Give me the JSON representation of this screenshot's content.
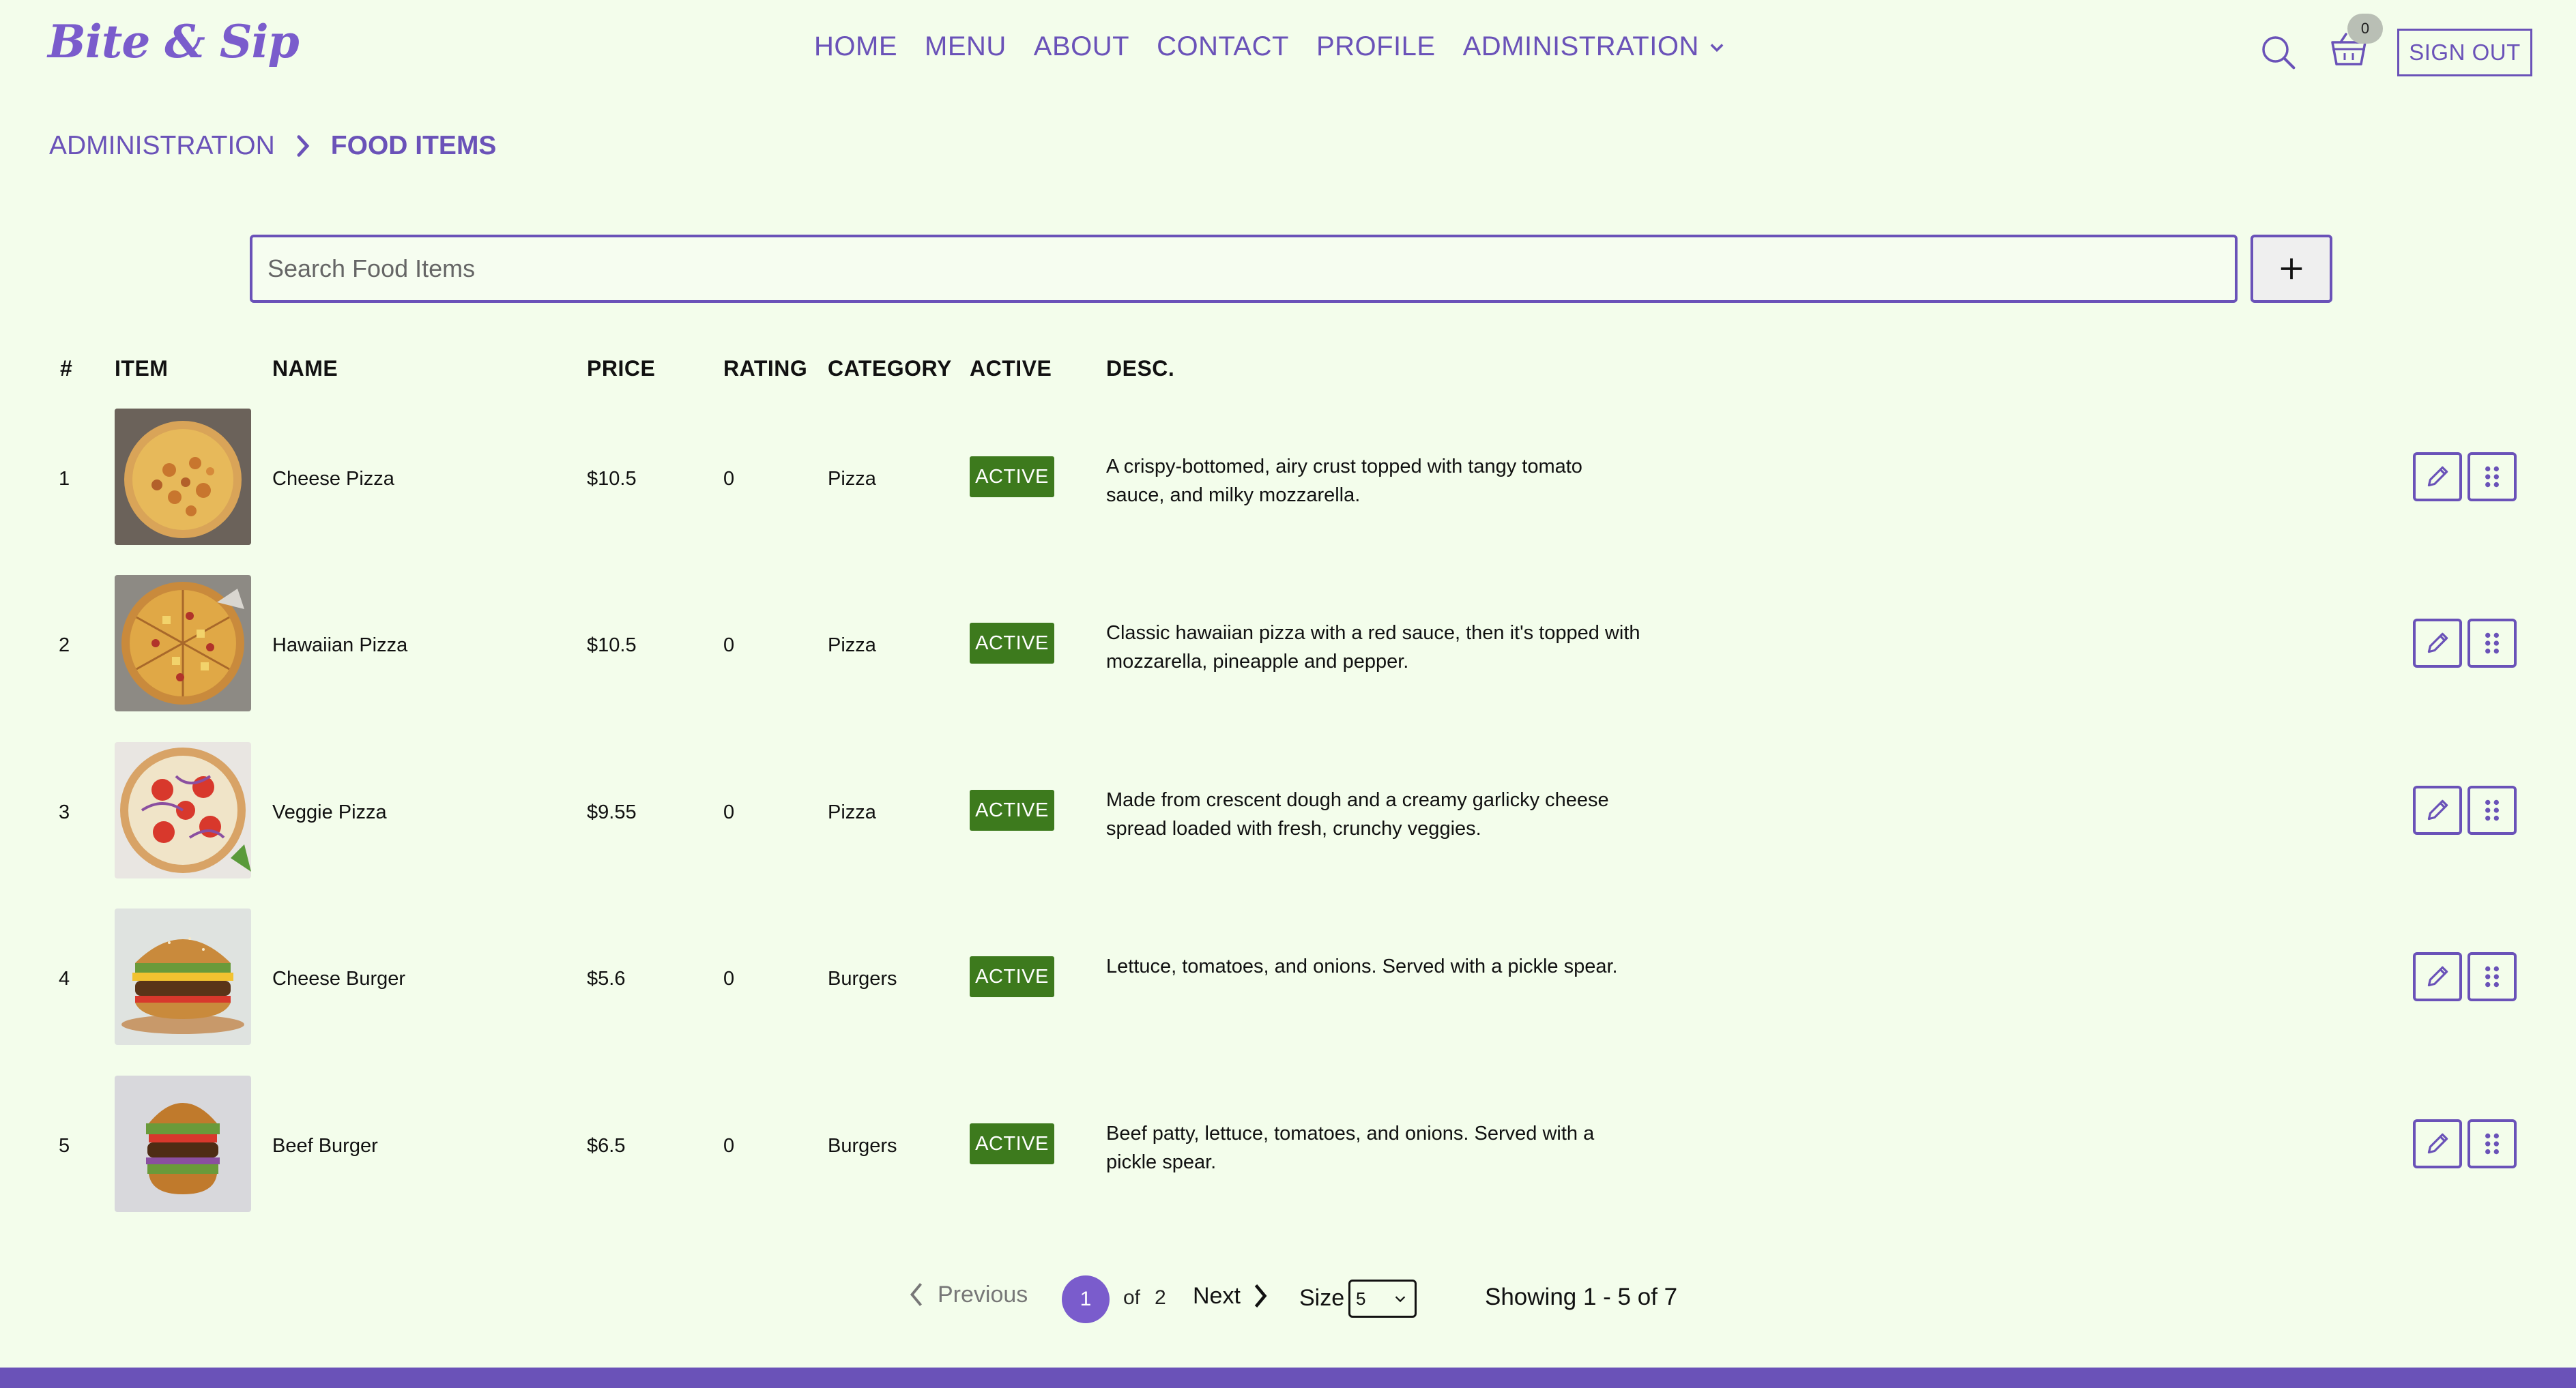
{
  "header": {
    "logo": "Bite & Sip",
    "nav": [
      "HOME",
      "MENU",
      "ABOUT",
      "CONTACT",
      "PROFILE"
    ],
    "admin_label": "ADMINISTRATION",
    "cart_count": "0",
    "signout_label": "SIGN OUT",
    "accent_color": "#6a52b8"
  },
  "breadcrumb": {
    "parent": "ADMINISTRATION",
    "current": "FOOD ITEMS"
  },
  "search": {
    "placeholder": "Search Food Items",
    "value": "",
    "add_icon": "plus-icon"
  },
  "table": {
    "headers": {
      "num": "#",
      "item": "ITEM",
      "name": "NAME",
      "price": "PRICE",
      "rating": "RATING",
      "category": "CATEGORY",
      "active": "ACTIVE",
      "desc": "DESC."
    },
    "rows": [
      {
        "num": "1",
        "name": "Cheese Pizza",
        "price": "$10.5",
        "rating": "0",
        "category": "Pizza",
        "status": "ACTIVE",
        "desc": "A crispy-bottomed, airy crust topped with tangy tomato sauce, and milky mozzarella.",
        "image": "cheese-pizza"
      },
      {
        "num": "2",
        "name": "Hawaiian Pizza",
        "price": "$10.5",
        "rating": "0",
        "category": "Pizza",
        "status": "ACTIVE",
        "desc": "Classic hawaiian pizza with a red sauce, then it's topped with mozzarella, pineapple and pepper.",
        "image": "hawaiian-pizza"
      },
      {
        "num": "3",
        "name": "Veggie Pizza",
        "price": "$9.55",
        "rating": "0",
        "category": "Pizza",
        "status": "ACTIVE",
        "desc": "Made from crescent dough and a creamy garlicky cheese spread loaded with fresh, crunchy veggies.",
        "image": "veggie-pizza"
      },
      {
        "num": "4",
        "name": "Cheese Burger",
        "price": "$5.6",
        "rating": "0",
        "category": "Burgers",
        "status": "ACTIVE",
        "desc": "Lettuce, tomatoes, and onions. Served with a pickle spear.",
        "image": "cheese-burger"
      },
      {
        "num": "5",
        "name": "Beef Burger",
        "price": "$6.5",
        "rating": "0",
        "category": "Burgers",
        "status": "ACTIVE",
        "desc": "Beef patty, lettuce, tomatoes, and onions. Served with a pickle spear.",
        "image": "beef-burger"
      }
    ],
    "row_actions": [
      "edit-icon",
      "drag-handle-icon"
    ]
  },
  "pagination": {
    "previous": "Previous",
    "current_page": "1",
    "of": "of",
    "total_pages": "2",
    "next": "Next",
    "size_label": "Size",
    "size_value": "5",
    "showing": "Showing 1 - 5 of 7"
  }
}
